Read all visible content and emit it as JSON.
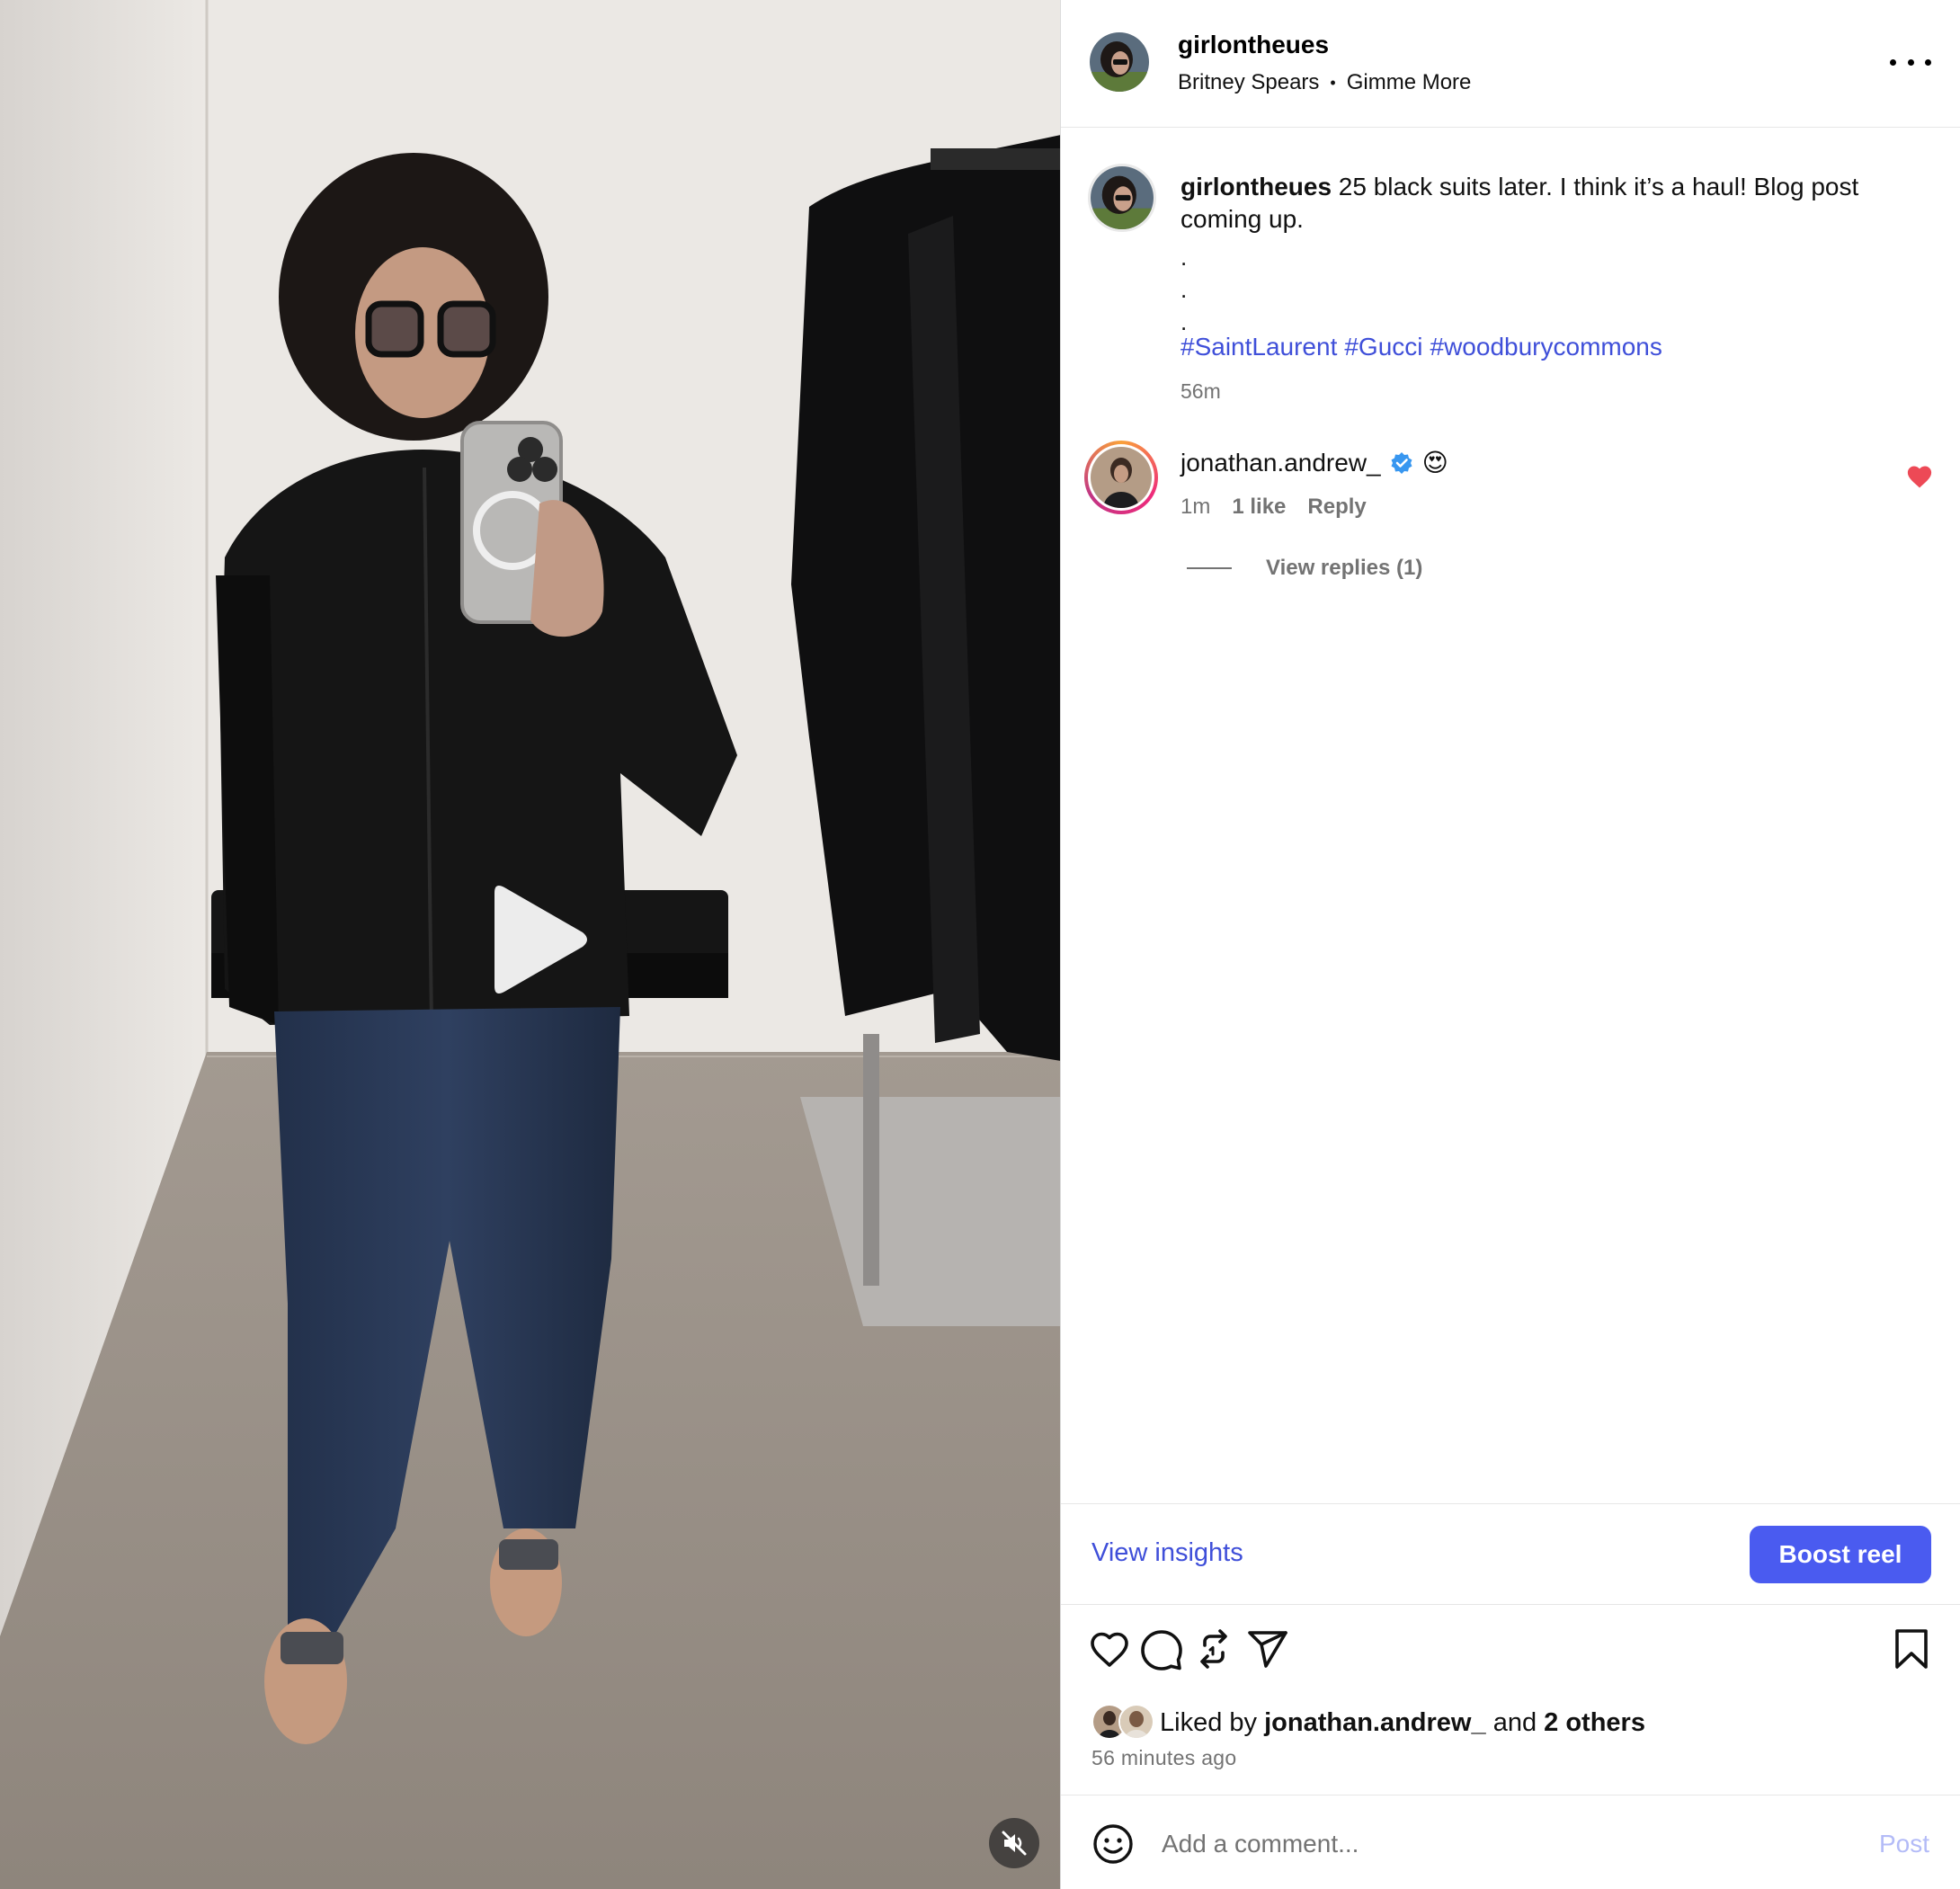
{
  "media": {
    "play_icon": "play-icon",
    "mute_icon": "speaker-muted-icon"
  },
  "header": {
    "username": "girlontheues",
    "audio_artist": "Britney Spears",
    "audio_separator": "•",
    "audio_track": "Gimme More",
    "more_icon": "more-options-icon"
  },
  "caption": {
    "username": "girlontheues",
    "text": "25 black suits later. I think it’s a haul! Blog post coming up.",
    "dots": [
      ".",
      ".",
      "."
    ],
    "hashtags": [
      "#SaintLaurent",
      "#Gucci",
      "#woodburycommons"
    ],
    "time": "56m"
  },
  "comments": [
    {
      "username": "jonathan.andrew_",
      "verified_icon": "verified-badge-icon",
      "text": "😍",
      "time": "1m",
      "likes": "1 like",
      "reply_label": "Reply",
      "view_replies": "View replies (1)",
      "liked": true
    }
  ],
  "footer": {
    "view_insights": "View insights",
    "boost_label": "Boost reel",
    "action_icons": [
      "heart-icon",
      "comment-icon",
      "repost-icon",
      "share-icon",
      "bookmark-icon"
    ],
    "liked_prefix": "Liked by",
    "liked_user": "jonathan.andrew_",
    "liked_and": "and",
    "liked_others": "2 others",
    "time_ago": "56 minutes ago",
    "comment_placeholder": "Add a comment...",
    "post_label": "Post"
  },
  "colors": {
    "link_blue": "#3f4fd9",
    "button_blue": "#4a5bf0",
    "heart_red": "#ed4956",
    "muted_gray": "#737373"
  }
}
